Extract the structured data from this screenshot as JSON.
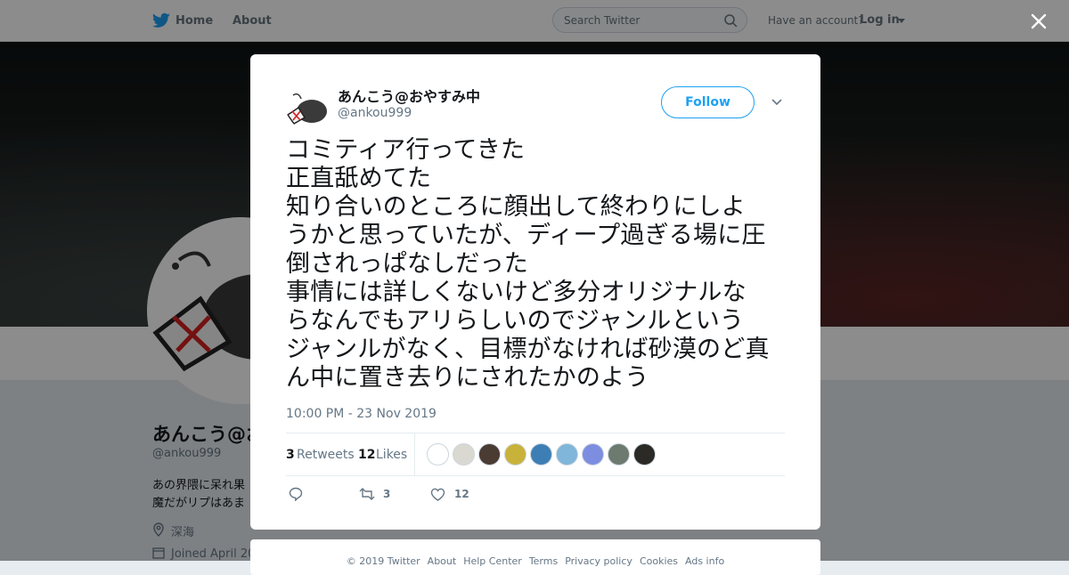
{
  "nav": {
    "home": "Home",
    "about": "About",
    "search_placeholder": "Search Twitter",
    "account_question": "Have an account?",
    "login": "Log in",
    "brand_color": "#1da1f2"
  },
  "profile": {
    "name": "あんこう@おやすみ中",
    "handle": "@ankou999",
    "bio_line1": "あの界隈に呆れ果",
    "bio_line2": "魔だがリプはあま",
    "location": "深海",
    "joined": "Joined April 20"
  },
  "tweet": {
    "author_name": "あんこう@おやすみ中",
    "author_handle": "@ankou999",
    "follow_label": "Follow",
    "text": "コミティア行ってきた\n正直舐めてた\n知り合いのところに顔出して終わりにしよ\nうかと思っていたが、ディープ過ぎる場に圧\n倒されっぱなしだった\n事情には詳しくないけど多分オリジナルな\nらなんでもアリらしいのでジャンルという\nジャンルがなく、目標がなければ砂漠のど真\nん中に置き去りにされたかのよう",
    "timestamp": "10:00 PM - 23 Nov 2019",
    "retweets_count": "3",
    "retweets_label": "Retweets",
    "likes_count": "12",
    "likes_label": "Likes",
    "action_retweet_count": "3",
    "action_like_count": "12"
  },
  "likers": [
    {
      "name": "liker-1",
      "color": "#ffffff"
    },
    {
      "name": "liker-2",
      "color": "#d9d9d2"
    },
    {
      "name": "liker-3",
      "color": "#4a3b33"
    },
    {
      "name": "liker-4",
      "color": "#c9b23a"
    },
    {
      "name": "liker-5",
      "color": "#3d7fb5"
    },
    {
      "name": "liker-6",
      "color": "#7fb6d9"
    },
    {
      "name": "liker-7",
      "color": "#7d8ee0"
    },
    {
      "name": "liker-8",
      "color": "#6d7a6f"
    },
    {
      "name": "liker-9",
      "color": "#2c2a26"
    }
  ],
  "footer": {
    "links": [
      "© 2019 Twitter",
      "About",
      "Help Center",
      "Terms",
      "Privacy policy",
      "Cookies",
      "Ads info"
    ]
  }
}
